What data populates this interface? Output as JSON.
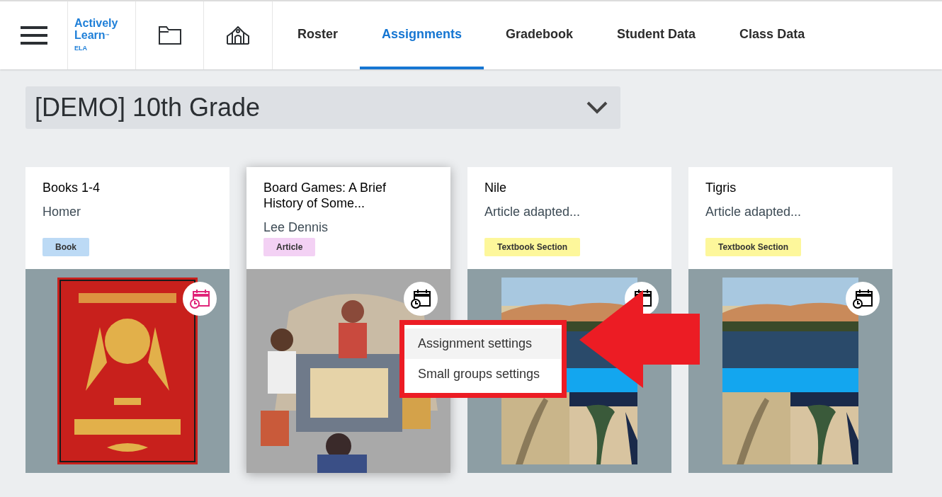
{
  "logo": {
    "name": "Actively Learn",
    "trademark": "™",
    "subject": "ELA"
  },
  "nav_tabs": [
    {
      "label": "Roster",
      "selected": false
    },
    {
      "label": "Assignments",
      "selected": true
    },
    {
      "label": "Gradebook",
      "selected": false
    },
    {
      "label": "Student Data",
      "selected": false
    },
    {
      "label": "Class Data",
      "selected": false
    }
  ],
  "class_selector": {
    "value": "[DEMO] 10th Grade"
  },
  "cards": [
    {
      "title": "Books 1-4",
      "author": "Homer",
      "tag": {
        "label": "Book",
        "color": "#bcdaf5"
      },
      "schedule_icon": {
        "color": "#e0257a"
      },
      "selected": false,
      "kind": "book"
    },
    {
      "title": "Board Games: A Brief History of Some...",
      "author": "Lee Dennis",
      "tag": {
        "label": "Article",
        "color": "#f3d1f4"
      },
      "schedule_icon": {
        "color": "#000000"
      },
      "selected": true,
      "kind": "illustration"
    },
    {
      "title": "Nile",
      "author": "Article adapted...",
      "tag": {
        "label": "Textbook Section",
        "color": "#fdf79b"
      },
      "schedule_icon": {
        "color": "#000000"
      },
      "selected": false,
      "kind": "collage"
    },
    {
      "title": "Tigris",
      "author": "Article adapted...",
      "tag": {
        "label": "Textbook Section",
        "color": "#fdf79b"
      },
      "schedule_icon": {
        "color": "#000000"
      },
      "selected": false,
      "kind": "collage"
    }
  ],
  "context_menu": {
    "items": [
      {
        "label": "Assignment settings",
        "selected": true
      },
      {
        "label": "Small groups settings",
        "selected": false
      }
    ]
  }
}
